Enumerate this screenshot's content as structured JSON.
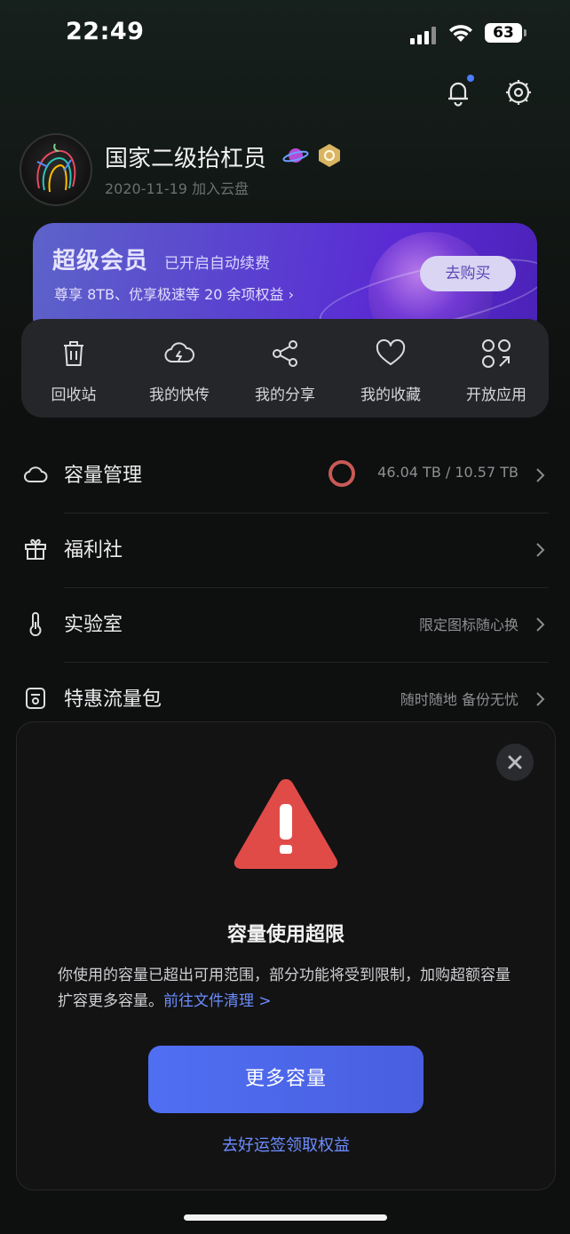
{
  "status_bar": {
    "time": "22:49",
    "battery": "63"
  },
  "profile": {
    "name": "国家二级抬杠员",
    "joined": "2020-11-19 加入云盘"
  },
  "vip": {
    "title": "超级会员",
    "status": "已开启自动续费",
    "benefits": "尊享 8TB、优享极速等 20 余项权益 ›",
    "buy_label": "去购买"
  },
  "quick_actions": [
    {
      "label": "回收站",
      "icon": "trash-icon"
    },
    {
      "label": "我的快传",
      "icon": "cloud-bolt-icon"
    },
    {
      "label": "我的分享",
      "icon": "share-icon"
    },
    {
      "label": "我的收藏",
      "icon": "heart-icon"
    },
    {
      "label": "开放应用",
      "icon": "apps-icon"
    }
  ],
  "menu": [
    {
      "title": "容量管理",
      "right": "46.04 TB / 10.57 TB",
      "icon": "cloud-icon"
    },
    {
      "title": "福利社",
      "right": "",
      "icon": "gift-icon"
    },
    {
      "title": "实验室",
      "right": "限定图标随心换",
      "icon": "thermometer-icon"
    },
    {
      "title": "特惠流量包",
      "right": "随时随地 备份无忧",
      "icon": "sim-card-icon"
    }
  ],
  "dialog": {
    "title": "容量使用超限",
    "body": "你使用的容量已超出可用范围，部分功能将受到限制，加购超额容量扩容更多容量。",
    "link": "前往文件清理 >",
    "primary_label": "更多容量",
    "secondary_label": "去好运签领取权益"
  },
  "colors": {
    "accent": "#4f6ff2",
    "warning": "#e04b48",
    "capacity_ring": "#c75a55"
  }
}
